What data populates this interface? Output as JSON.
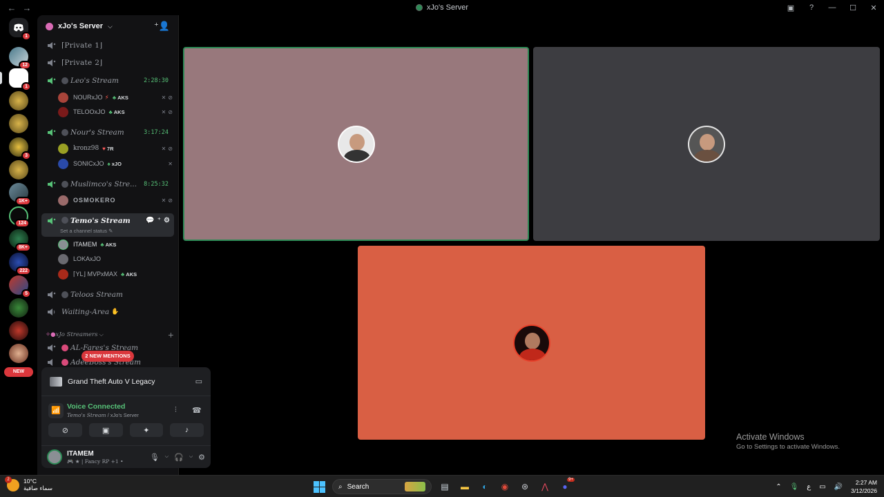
{
  "window": {
    "title": "xJo's Server",
    "back": "←",
    "forward": "→"
  },
  "server": {
    "name": "xJo's Server"
  },
  "rail_badges": [
    "1",
    "12",
    "1",
    "3",
    "1K+",
    "124",
    "8K+",
    "222",
    "5"
  ],
  "rail_new": "NEW",
  "channels": {
    "private1": "⌈Private 1⌋",
    "private2": "⌈Private 2⌋",
    "leo": {
      "name": "Leo's Stream",
      "time": "2:28:30"
    },
    "nour": {
      "name": "Nour's Stream",
      "time": "3:17:24"
    },
    "muslimco": {
      "name": "Muslimco's Stre...",
      "time": "8:25:32"
    },
    "temo": {
      "name": "Temo's Stream",
      "status": "Set a channel status"
    },
    "teloos": {
      "name": "Teloos Stream"
    },
    "waiting": {
      "name": "Waiting-Area"
    },
    "category": "xJo Streamers",
    "alfares": {
      "name": "AL-Fares's Stream"
    },
    "adeeb": {
      "name": "AdeeBoss's Stream"
    }
  },
  "users": {
    "nourxjo": {
      "name": "NOURxJO",
      "tag": "AKS"
    },
    "teloo": {
      "name": "TELOOxJO",
      "tag": "AKS"
    },
    "kronz": {
      "name": "kronz98",
      "tag": "7R"
    },
    "sonic": {
      "name": "SONICxJO",
      "tag": "xJO"
    },
    "osmoker": {
      "name": "OSMOKERO"
    },
    "itamem": {
      "name": "ITAMEM",
      "tag": "AKS"
    },
    "loka": {
      "name": "LOKAxJO"
    },
    "mvp": {
      "name": "⌈YL⌋ MVPxMAX",
      "tag": "AKS"
    }
  },
  "mentions": "2 NEW MENTIONS",
  "panel": {
    "activity": "Grand Theft Auto V Legacy",
    "voice_status": "Voice Connected",
    "voice_channel": "Temo's Stream",
    "voice_server": " / xJo's Server",
    "me_name": "ITAMEM",
    "me_status": "★ | Fancy RP +1 •"
  },
  "tiles": [
    {
      "id": "tile-1",
      "bg": "#98787c"
    },
    {
      "id": "tile-2",
      "bg": "#3d3d41"
    },
    {
      "id": "tile-3",
      "bg": "#d95f44"
    }
  ],
  "watermark": {
    "line1": "Activate Windows",
    "line2": "Go to Settings to activate Windows."
  },
  "taskbar": {
    "temp": "10°C",
    "condition": "سماء صافية",
    "weather_badge": "2",
    "search": "Search",
    "lang": "ع",
    "time": "2:27 AM",
    "date": "3/12/2026",
    "discord_badge": "9+"
  }
}
